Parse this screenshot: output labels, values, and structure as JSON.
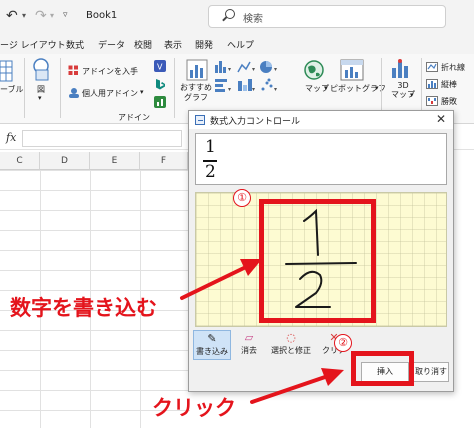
{
  "titlebar": {
    "workbook": "Book1",
    "search_placeholder": "検索"
  },
  "menu_tabs": [
    "ージ レイアウト",
    "数式",
    "データ",
    "校閲",
    "表示",
    "開発",
    "ヘルプ"
  ],
  "ribbon": {
    "left_partial": "ーブル",
    "figure": "図",
    "addin_get": "アドインを入手",
    "addin_personal": "個人用アドイン",
    "addin_group": "アドイン",
    "recommended_chart": "おすすめ\nグラフ",
    "map": "マップ",
    "pivot_chart": "ピボットグラフ",
    "map_3d": "3D\nマップ",
    "sparkline_line": "折れ線",
    "sparkline_column": "縦棒",
    "sparkline_winloss": "勝敗"
  },
  "formula_bar": {
    "fx": "fx"
  },
  "columns": [
    "C",
    "D",
    "E",
    "F"
  ],
  "dialog": {
    "title": "数式入力コントロール",
    "preview": {
      "numerator": "1",
      "denominator": "2"
    },
    "tools": [
      "書き込み",
      "消去",
      "選択と修正",
      "クリア"
    ],
    "insert_label": "挿入",
    "cancel_label": "取り消す"
  },
  "annotations": {
    "step1": "①",
    "step2": "②",
    "write_callout": "数字を書き込む",
    "click_callout": "クリック"
  },
  "colors": {
    "annotation_red": "#e4141c",
    "writing_pad": "#fdfbd2",
    "selected_tool": "#cfe3f7"
  }
}
